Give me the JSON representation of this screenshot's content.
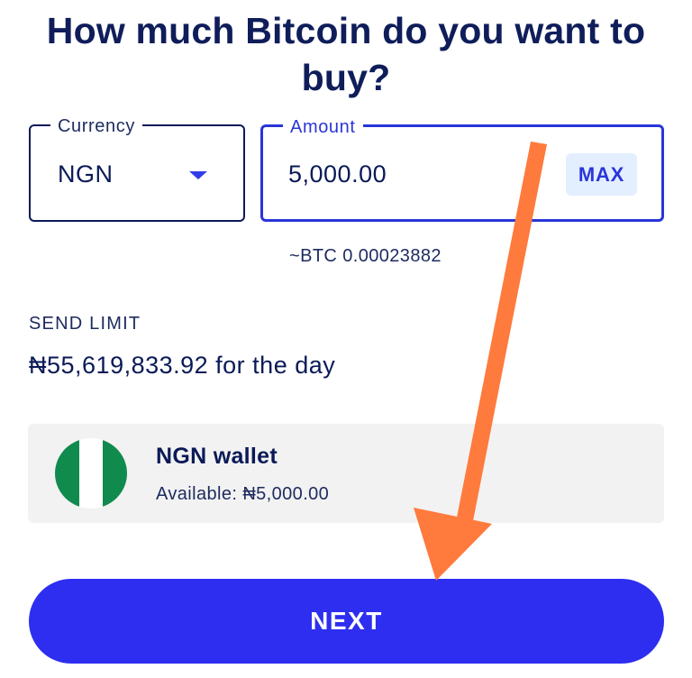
{
  "page": {
    "title": "How much Bitcoin do you want to buy?"
  },
  "currency": {
    "label": "Currency",
    "value": "NGN"
  },
  "amount": {
    "label": "Amount",
    "value": "5,000.00",
    "max_label": "MAX"
  },
  "conversion": {
    "btc_estimate": "~BTC 0.00023882"
  },
  "send_limit": {
    "label": "SEND LIMIT",
    "value": "₦55,619,833.92 for the day"
  },
  "wallet": {
    "name": "NGN wallet",
    "available": "Available: ₦5,000.00",
    "icon": "nigeria-flag-icon"
  },
  "actions": {
    "next_label": "NEXT"
  },
  "colors": {
    "primary": "#2d2ef0",
    "text_dark": "#0a1a57",
    "annotation_arrow": "#ff7a3d",
    "flag_green": "#118a4e"
  }
}
